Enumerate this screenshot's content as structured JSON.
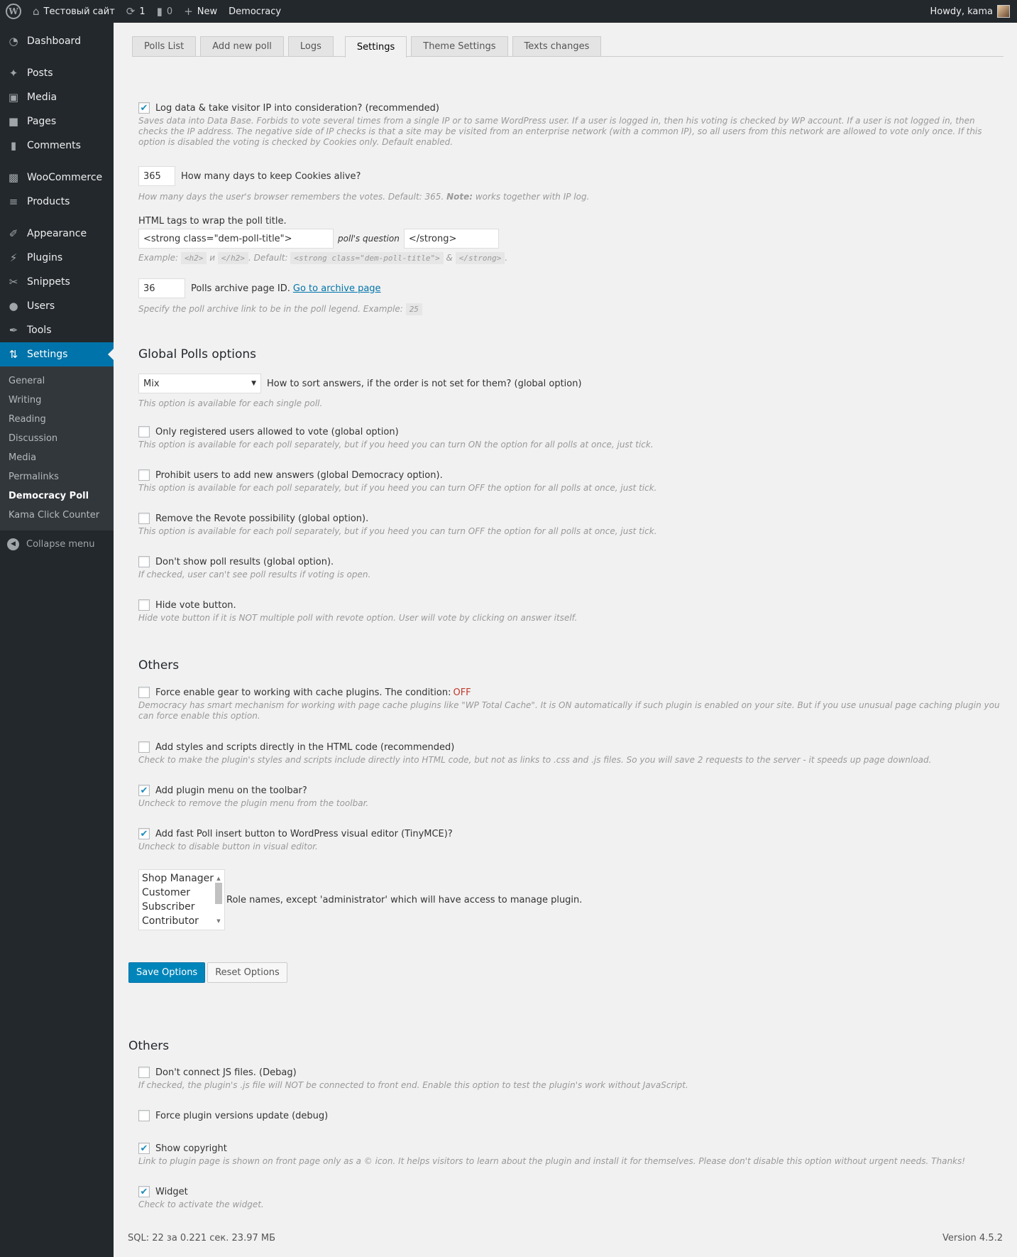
{
  "adminbar": {
    "site_name": "Тестовый сайт",
    "updates_count": "1",
    "comments_count": "0",
    "new_label": "New",
    "plugin_label": "Democracy",
    "howdy": "Howdy, kama"
  },
  "sidebar": {
    "items": [
      {
        "label": "Dashboard",
        "icon": "dashboard-icon"
      },
      {
        "label": "Posts",
        "icon": "pin-icon"
      },
      {
        "label": "Media",
        "icon": "media-icon"
      },
      {
        "label": "Pages",
        "icon": "pages-icon"
      },
      {
        "label": "Comments",
        "icon": "comment-icon"
      },
      {
        "label": "WooCommerce",
        "icon": "woo-icon"
      },
      {
        "label": "Products",
        "icon": "cart-icon"
      },
      {
        "label": "Appearance",
        "icon": "brush-icon"
      },
      {
        "label": "Plugins",
        "icon": "plugin-icon"
      },
      {
        "label": "Snippets",
        "icon": "scissors-icon"
      },
      {
        "label": "Users",
        "icon": "user-icon"
      },
      {
        "label": "Tools",
        "icon": "wrench-icon"
      },
      {
        "label": "Settings",
        "icon": "settings-icon"
      }
    ],
    "submenu": [
      "General",
      "Writing",
      "Reading",
      "Discussion",
      "Media",
      "Permalinks",
      "Democracy Poll",
      "Kama Click Counter"
    ],
    "current_submenu": "Democracy Poll",
    "collapse_label": "Collapse menu"
  },
  "tabs": [
    "Polls List",
    "Add new poll",
    "Logs",
    "Settings",
    "Theme Settings",
    "Texts changes"
  ],
  "active_tab": "Settings",
  "settings": {
    "log_ip": {
      "checked": true,
      "label": "Log data & take visitor IP into consideration? (recommended)",
      "desc": "Saves data into Data Base. Forbids to vote several times from a single IP or to same WordPress user. If a user is logged in, then his voting is checked by WP account. If a user is not logged in, then checks the IP address. The negative side of IP checks is that a site may be visited from an enterprise network (with a common IP), so all users from this network are allowed to vote only once. If this option is disabled the voting is checked by Cookies only. Default enabled."
    },
    "cookie_days": {
      "value": "365",
      "label": "How many days to keep Cookies alive?",
      "desc_pre": "How many days the user's browser remembers the votes. Default: 365. ",
      "desc_note": "Note:",
      "desc_post": " works together with IP log."
    },
    "title_tags": {
      "label": "HTML tags to wrap the poll title.",
      "open_value": "<strong class=\"dem-poll-title\">",
      "middle_label": "poll's question",
      "close_value": "</strong>",
      "ex_prefix": "Example:",
      "ex_open": "<h2>",
      "ex_and": "и",
      "ex_close": "</h2>",
      "ex_default": ". Default:",
      "def_open": "<strong class=\"dem-poll-title\">",
      "def_amp": "&",
      "def_close": "</strong>"
    },
    "archive": {
      "value": "36",
      "label": "Polls archive page ID.",
      "link": "Go to archive page",
      "desc": "Specify the poll archive link to be in the poll legend. Example:",
      "example": "25"
    }
  },
  "global": {
    "heading": "Global Polls options",
    "sort": {
      "selected": "Mix",
      "label": "How to sort answers, if the order is not set for them? (global option)",
      "desc": "This option is available for each single poll."
    },
    "options": [
      {
        "checked": false,
        "label": "Only registered users allowed to vote (global option)",
        "desc": "This option is available for each poll separately, but if you heed you can turn ON the option for all polls at once, just tick."
      },
      {
        "checked": false,
        "label": "Prohibit users to add new answers (global Democracy option).",
        "desc": "This option is available for each poll separately, but if you heed you can turn OFF the option for all polls at once, just tick."
      },
      {
        "checked": false,
        "label": "Remove the Revote possibility (global option).",
        "desc": "This option is available for each poll separately, but if you heed you can turn OFF the option for all polls at once, just tick."
      },
      {
        "checked": false,
        "label": "Don't show poll results (global option).",
        "desc": "If checked, user can't see poll results if voting is open."
      },
      {
        "checked": false,
        "label": "Hide vote button.",
        "desc": "Hide vote button if it is NOT multiple poll with revote option. User will vote by clicking on answer itself."
      }
    ]
  },
  "others": {
    "heading": "Others",
    "cache": {
      "checked": false,
      "label": "Force enable gear to working with cache plugins. The condition:",
      "state": "OFF",
      "desc": "Democracy has smart mechanism for working with page cache plugins like \"WP Total Cache\". It is ON automatically if such plugin is enabled on your site. But if you use unusual page caching plugin you can force enable this option."
    },
    "options": [
      {
        "checked": false,
        "label": "Add styles and scripts directly in the HTML code (recommended)",
        "desc": "Check to make the plugin's styles and scripts include directly into HTML code, but not as links to .css and .js files. So you will save 2 requests to the server - it speeds up page download."
      },
      {
        "checked": true,
        "label": "Add plugin menu on the toolbar?",
        "desc": "Uncheck to remove the plugin menu from the toolbar."
      },
      {
        "checked": true,
        "label": "Add fast Poll insert button to WordPress visual editor (TinyMCE)?",
        "desc": "Uncheck to disable button in visual editor."
      }
    ],
    "roles": [
      "Shop Manager",
      "Customer",
      "Subscriber",
      "Contributor"
    ],
    "roles_label": "Role names, except 'administrator' which will have access to manage plugin.",
    "save_label": "Save Options",
    "reset_label": "Reset Options"
  },
  "debug": {
    "heading": "Others",
    "options": [
      {
        "checked": false,
        "label": "Don't connect JS files. (Debag)",
        "desc": "If checked, the plugin's .js file will NOT be connected to front end. Enable this option to test the plugin's work without JavaScript."
      },
      {
        "checked": false,
        "label": "Force plugin versions update (debug)",
        "desc": ""
      },
      {
        "checked": true,
        "label": "Show copyright",
        "desc": "Link to plugin page is shown on front page only as a © icon. It helps visitors to learn about the plugin and install it for themselves. Please don't disable this option without urgent needs. Thanks!"
      },
      {
        "checked": true,
        "label": "Widget",
        "desc": "Check to activate the widget."
      }
    ]
  },
  "footer": {
    "stats": "SQL: 22 за 0.221 сек. 23.97 МБ",
    "version": "Version 4.5.2"
  },
  "colors": {
    "accent": "#0073aa",
    "button": "#0085ba",
    "off": "#c0392b",
    "sidebar": "#23282d"
  }
}
